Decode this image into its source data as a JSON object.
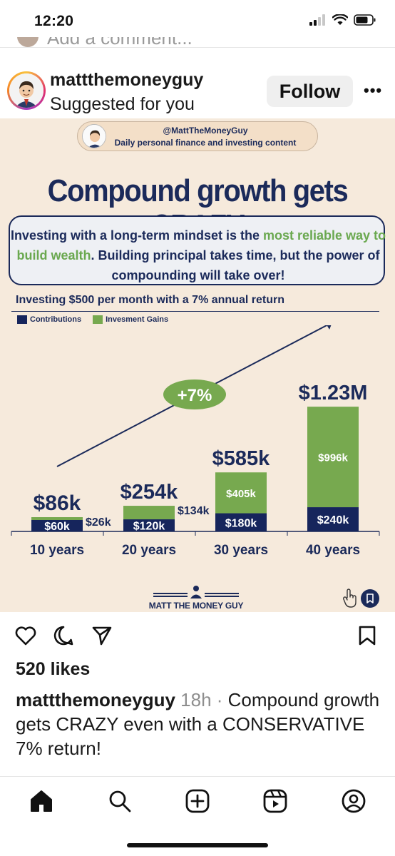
{
  "status_bar": {
    "time": "12:20"
  },
  "comment_peek": {
    "text": "Add a comment..."
  },
  "post": {
    "username": "mattthemoneyguy",
    "subtitle": "Suggested for you",
    "follow_label": "Follow",
    "more_label": "•••"
  },
  "infographic": {
    "handle": "@MattTheMoneyGuy",
    "tagline": "Daily personal finance and investing content",
    "title": "Compound growth gets CRAZY",
    "callout": {
      "part1": "Investing with a long-term mindset is the ",
      "highlight": "most reliable way to build wealth",
      "part2": ". Building principal takes time, but the power of compounding will take over!"
    },
    "brand": "MATT THE MONEY GUY"
  },
  "chart_data": {
    "type": "bar",
    "title": "Investing $500 per month with a 7% annual return",
    "categories": [
      "10 years",
      "20 years",
      "30 years",
      "40 years"
    ],
    "series": [
      {
        "name": "Contributions",
        "values": [
          60,
          120,
          180,
          240
        ],
        "labels": [
          "$60k",
          "$120k",
          "$180k",
          "$240k"
        ],
        "color": "#16255c"
      },
      {
        "name": "Invesment Gains",
        "values": [
          26,
          134,
          405,
          996
        ],
        "labels": [
          "$26k",
          "$134k",
          "$405k",
          "$996k"
        ],
        "color": "#77a94f"
      }
    ],
    "totals": [
      "$86k",
      "$254k",
      "$585k",
      "$1.23M"
    ],
    "units": "thousands of dollars",
    "stacked": true,
    "annotation": "+7%",
    "legend_position": "top-left"
  },
  "engagement": {
    "likes": "520 likes",
    "caption_user": "mattthemoneyguy",
    "caption_time": "18h",
    "caption_sep": " · ",
    "caption_text": "Compound growth gets CRAZY even with a CONSERVATIVE 7% return!"
  },
  "icons": {
    "like": "heart-icon",
    "comment": "comment-icon",
    "share": "share-icon",
    "save": "bookmark-icon",
    "tabs": [
      "home-icon",
      "search-icon",
      "create-icon",
      "reels-icon",
      "profile-icon"
    ]
  },
  "colors": {
    "navy": "#1b2a5a",
    "green": "#6aa84f",
    "background": "#f6eadc"
  }
}
